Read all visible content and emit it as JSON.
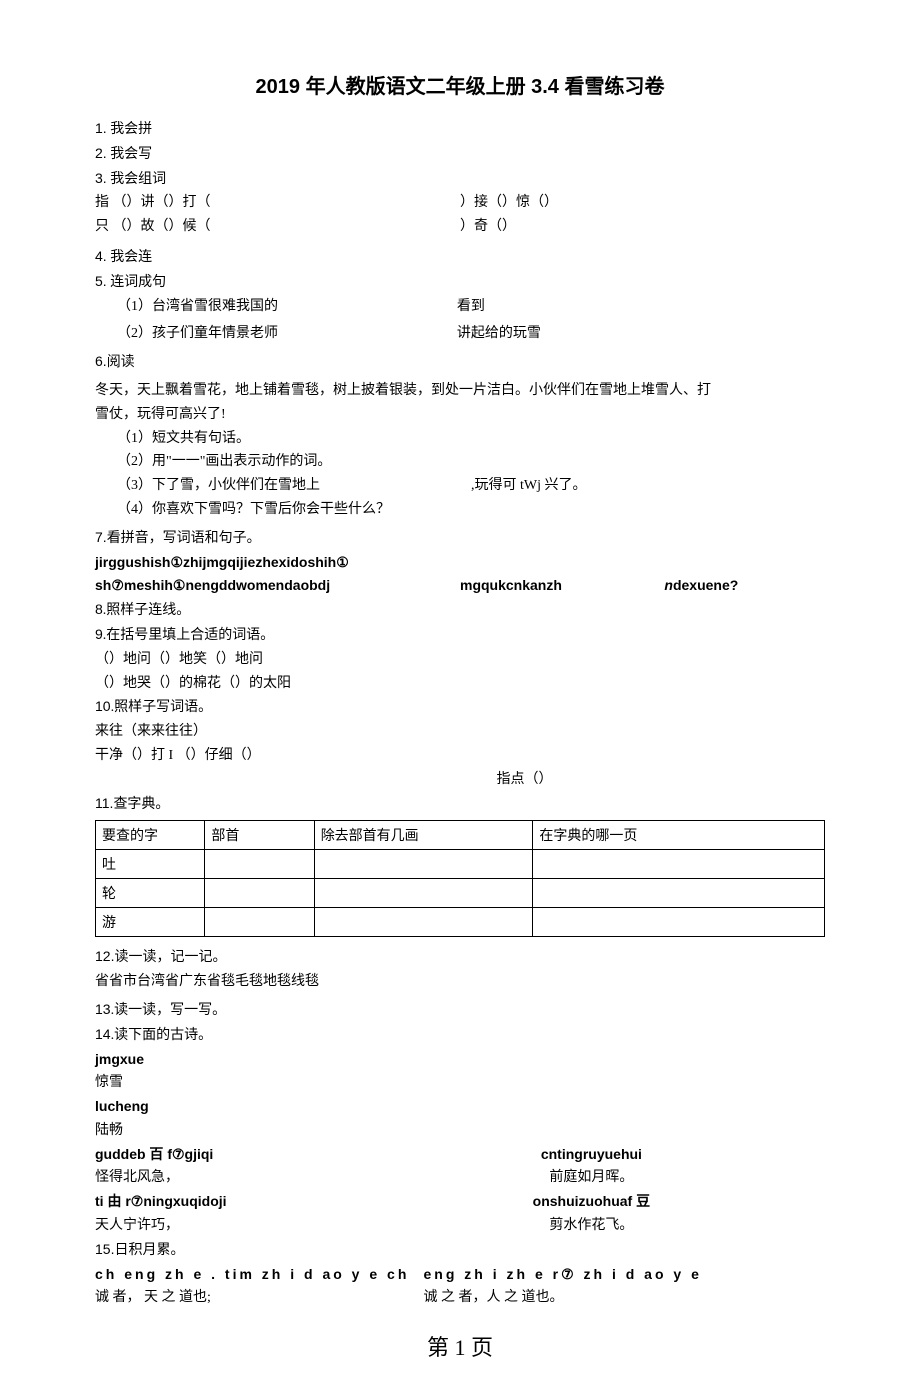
{
  "title": "2019 年人教版语文二年级上册 3.4 看雪练习卷",
  "q1": {
    "num": "1.",
    "text": "我会拼"
  },
  "q2": {
    "num": "2.",
    "text": "我会写"
  },
  "q3": {
    "num": "3.",
    "text": "我会组词",
    "left1": "指 （）讲（）打（",
    "right1": "）接（）惊（）",
    "left2": "只 （）故（）候（",
    "right2": "）奇（）"
  },
  "q4": {
    "num": "4.",
    "text": "我会连"
  },
  "q5": {
    "num": "5.",
    "text": "连词成句",
    "l1_left": "（1）台湾省雪很难我国的",
    "l1_right": "看到",
    "l2_left": "（2）孩子们童年情景老师",
    "l2_right": "讲起给的玩雪"
  },
  "q6": {
    "num": "6.",
    "heading": "阅读",
    "p1": "冬天，天上飘着雪花，地上铺着雪毯，树上披着银装，到处一片洁白。小伙伴们在雪地上堆雪人、打",
    "p2": "雪仗，玩得可高兴了!",
    "s1": "（1）短文共有句话。",
    "s2": "（2）用\"一一\"画出表示动作的词。",
    "s3_left": "（3）下了雪，小伙伴们在雪地上",
    "s3_right": ",玩得可 tWj 兴了。",
    "s4": "（4）你喜欢下雪吗？下雪后你会干些什么？"
  },
  "q7": {
    "num": "7.",
    "heading": "看拼音，写词语和句子。",
    "p1": "jirggushish①zhijmgqijiezhexidoshih①",
    "p2_left": "sh⑦meshih①nengddwomendaobdj",
    "p2_mid": "mgqukcnkanzh",
    "p2_right_i": "n",
    "p2_right": "dexuene?"
  },
  "q8": {
    "num": "8",
    "heading": ".照样子连线。"
  },
  "q9": {
    "num": "9",
    "heading": ".在括号里填上合适的词语。",
    "l1": "（）地问（）地笑（）地问",
    "l2": "（）地哭（）的棉花（）的太阳"
  },
  "q10": {
    "num": "10",
    "heading": ".照样子写词语。",
    "l1": "来往（来来往往）",
    "l2": "干净（）打 I （）仔细（）",
    "r": "指点（）"
  },
  "q11": {
    "num": "11.",
    "heading": "查字典。",
    "th1": "要查的字",
    "th2": "部首",
    "th3": "除去部首有几画",
    "th4": "在字典的哪一页",
    "r1": "吐",
    "r2": "轮",
    "r3": "游"
  },
  "q12": {
    "num": "12.",
    "heading": "读一读，记一记。",
    "l1": "省省市台湾省广东省毯毛毯地毯线毯"
  },
  "q13": {
    "num": "13",
    "heading": ".读一读，写一写。"
  },
  "q14": {
    "num": "14",
    "heading": ".读下面的古诗。",
    "py1": "jmgxue",
    "cn1": "惊雪",
    "py2": "lucheng",
    "cn2": "陆畅",
    "l1_left_py": "guddeb 百 f⑦gjiqi",
    "l1_right_py": "cntingruyuehui",
    "l1_left_cn": "怪得北风急，",
    "l1_right_cn": "前庭如月晖。",
    "l2_left_py": "ti 由 r⑦ningxuqidoji",
    "l2_right_py": "onshuizuohuaf 豆",
    "l2_left_cn": "天人宁许巧，",
    "l2_right_cn": "剪水作花飞。"
  },
  "q15": {
    "num": "15.",
    "heading": "日积月累。",
    "py_left": "ch eng zh e . tim zh i d ao y e ch",
    "py_right": "eng zh i zh e r⑦ zh i d ao y e",
    "cn_left": "诚 者， 天 之 道也;",
    "cn_right": "诚 之    者，人   之   道也。"
  },
  "footer": "第 1 页"
}
